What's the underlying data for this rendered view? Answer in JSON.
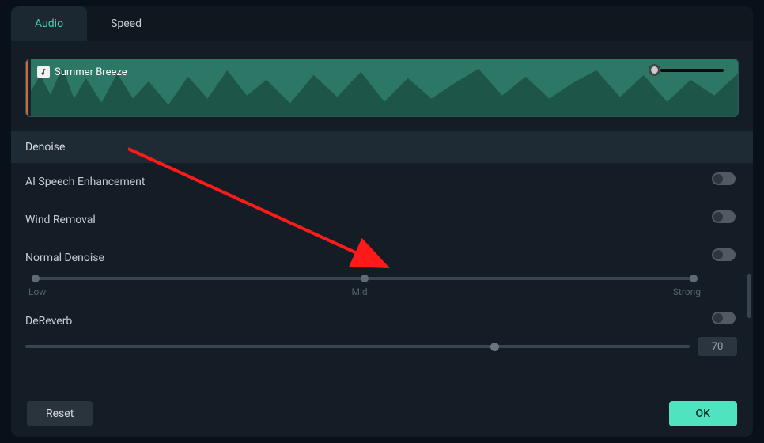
{
  "tabs": {
    "audio": "Audio",
    "speed": "Speed"
  },
  "track": {
    "name": "Summer Breeze"
  },
  "sections": {
    "denoise_header": "Denoise",
    "ai_speech": "AI Speech Enhancement",
    "wind_removal": "Wind Removal",
    "normal_denoise": {
      "label": "Normal Denoise",
      "low": "Low",
      "mid": "Mid",
      "strong": "Strong"
    },
    "dereverb": {
      "label": "DeReverb",
      "value": "70"
    }
  },
  "footer": {
    "reset": "Reset",
    "ok": "OK"
  }
}
